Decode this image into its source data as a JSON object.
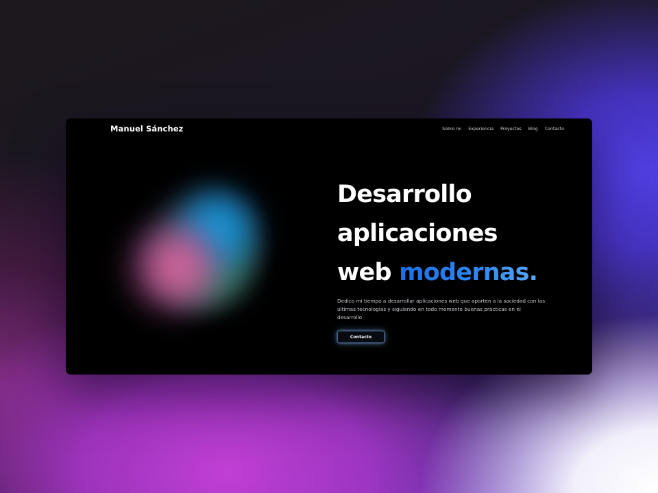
{
  "brand": {
    "name": "Manuel Sánchez"
  },
  "nav": {
    "items": [
      {
        "label": "Sobre mi"
      },
      {
        "label": "Experiencia"
      },
      {
        "label": "Proyectos"
      },
      {
        "label": "Blog"
      },
      {
        "label": "Contacto"
      }
    ]
  },
  "hero": {
    "title_line1": "Desarrollo",
    "title_line2": "aplicaciones",
    "title_line3_plain": "web ",
    "title_line3_accent": "modernas.",
    "description": "Dedico mi tiempo a desarrollar aplicaciones web que aporten a la sociedad con las ultimas tecnologias y siguiendo en todo momento buenas prácticas en el desarrollo",
    "cta_label": "Contacto"
  },
  "colors": {
    "accent": "#2f86f0",
    "window_bg": "#000000",
    "text": "#ffffff"
  }
}
